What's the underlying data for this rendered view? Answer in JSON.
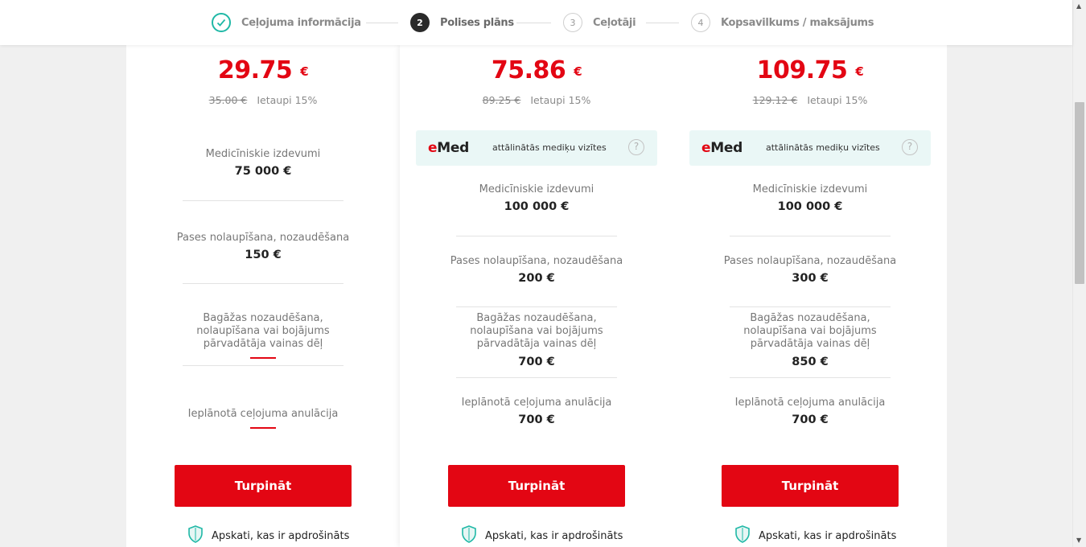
{
  "stepper": {
    "steps": [
      {
        "number": "✓",
        "label": "Ceļojuma informācija",
        "state": "done"
      },
      {
        "number": "2",
        "label": "Polises plāns",
        "state": "active"
      },
      {
        "number": "3",
        "label": "Ceļotāji",
        "state": "todo"
      },
      {
        "number": "4",
        "label": "Kopsavilkums / maksājums",
        "state": "todo"
      }
    ]
  },
  "currency": "€",
  "colors": {
    "brand_red": "#e30613",
    "teal": "#1fb8a6",
    "emed_bg": "#eaf7f6"
  },
  "emed": {
    "logo_e": "e",
    "logo_rest": "Med",
    "text": "attālinātās mediķu vizītes",
    "help": "?"
  },
  "plans": [
    {
      "price": "29.75",
      "old_price": "35.00 €",
      "saving": "Ietaupi 15%",
      "has_emed": false,
      "medical_label": "Medicīniskie izdevumi",
      "medical_value": "75 000 €",
      "passport_label": "Pases nolaupīšana, nozaudēšana",
      "passport_value": "150 €",
      "baggage_label_1": "Bagāžas nozaudēšana,",
      "baggage_label_2": "nolaupīšana vai bojājums",
      "baggage_label_3": "pārvadātāja vainas dēļ",
      "baggage_value": null,
      "cancel_label": "Ieplānotā ceļojuma anulācija",
      "cancel_value": null,
      "button": "Turpināt",
      "link": "Apskati, kas ir apdrošināts"
    },
    {
      "price": "75.86",
      "old_price": "89.25 €",
      "saving": "Ietaupi 15%",
      "has_emed": true,
      "medical_label": "Medicīniskie izdevumi",
      "medical_value": "100 000 €",
      "passport_label": "Pases nolaupīšana, nozaudēšana",
      "passport_value": "200 €",
      "baggage_label_1": "Bagāžas nozaudēšana,",
      "baggage_label_2": "nolaupīšana vai bojājums",
      "baggage_label_3": "pārvadātāja vainas dēļ",
      "baggage_value": "700 €",
      "cancel_label": "Ieplānotā ceļojuma anulācija",
      "cancel_value": "700 €",
      "button": "Turpināt",
      "link": "Apskati, kas ir apdrošināts"
    },
    {
      "price": "109.75",
      "old_price": "129.12 €",
      "saving": "Ietaupi 15%",
      "has_emed": true,
      "medical_label": "Medicīniskie izdevumi",
      "medical_value": "100 000 €",
      "passport_label": "Pases nolaupīšana, nozaudēšana",
      "passport_value": "300 €",
      "baggage_label_1": "Bagāžas nozaudēšana,",
      "baggage_label_2": "nolaupīšana vai bojājums",
      "baggage_label_3": "pārvadātāja vainas dēļ",
      "baggage_value": "850 €",
      "cancel_label": "Ieplānotā ceļojuma anulācija",
      "cancel_value": "700 €",
      "button": "Turpināt",
      "link": "Apskati, kas ir apdrošināts"
    }
  ]
}
